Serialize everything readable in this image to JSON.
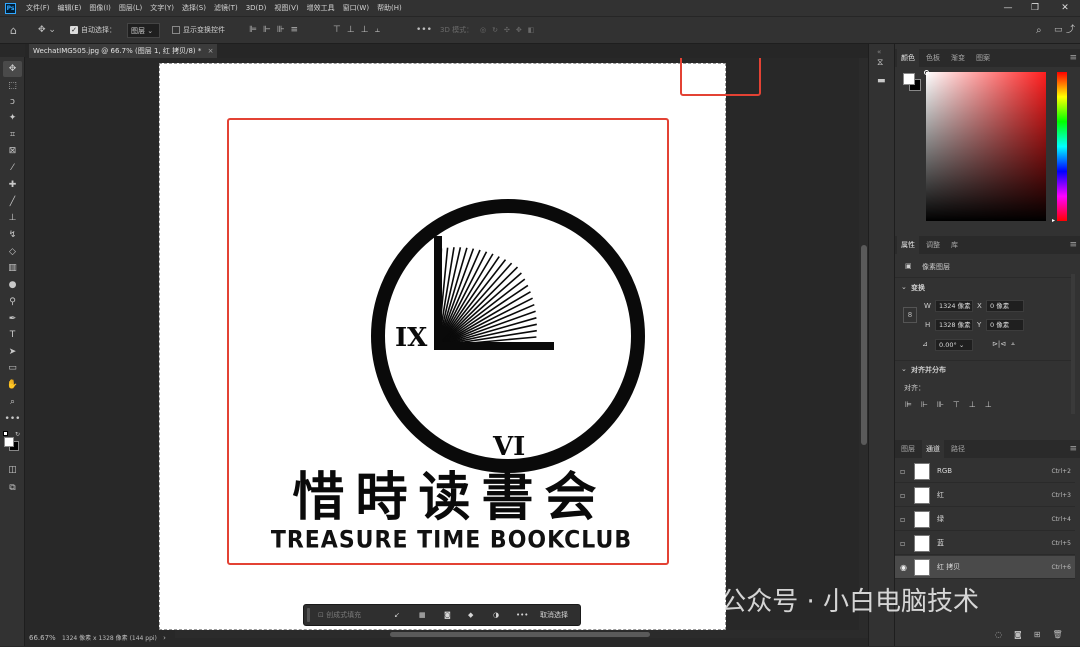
{
  "menubar": {
    "logo": "Ps",
    "items": [
      "文件(F)",
      "编辑(E)",
      "图像(I)",
      "图层(L)",
      "文字(Y)",
      "选择(S)",
      "滤镜(T)",
      "3D(D)",
      "视图(V)",
      "增效工具",
      "窗口(W)",
      "帮助(H)"
    ],
    "window_controls": [
      "—",
      "❐",
      "✕"
    ]
  },
  "options": {
    "auto_select_label": "自动选择：",
    "auto_select_value": "图层",
    "show_transform_label": "显示变换控件",
    "mode_3d_label": "3D 模式："
  },
  "document_tab": {
    "title": "WechatIMG505.jpg @ 66.7% (图层 1, 红 拷贝/8) *",
    "close": "×"
  },
  "canvas": {
    "logo_cn": "惜時读書会",
    "logo_en": "TREASURE TIME BOOKCLUB",
    "numeral_left": "IX",
    "numeral_bottom": "VI"
  },
  "context_bar": {
    "fill_label": "创成式填充",
    "deselect_label": "取消选择",
    "more": "•••"
  },
  "status": {
    "zoom": "66.67%",
    "info": "1324 像素 x 1328 像素 (144 ppi)",
    "arrow": "›"
  },
  "color_panel": {
    "tabs": [
      "颜色",
      "色板",
      "渐变",
      "图案"
    ]
  },
  "properties_panel": {
    "tabs": [
      "属性",
      "调整",
      "库"
    ],
    "layer_type": "像素图层",
    "transform_header": "变换",
    "w_label": "W",
    "w_value": "1324 像素",
    "x_label": "X",
    "x_value": "0 像素",
    "h_label": "H",
    "h_value": "1328 像素",
    "y_label": "Y",
    "y_value": "0 像素",
    "angle_value": "0.00°",
    "align_header": "对齐并分布",
    "align_label": "对齐："
  },
  "channels_panel": {
    "tabs": [
      "图层",
      "通道",
      "路径"
    ],
    "channels": [
      {
        "name": "RGB",
        "shortcut": "Ctrl+2",
        "visible": false,
        "selected": false
      },
      {
        "name": "红",
        "shortcut": "Ctrl+3",
        "visible": false,
        "selected": false
      },
      {
        "name": "绿",
        "shortcut": "Ctrl+4",
        "visible": false,
        "selected": false
      },
      {
        "name": "蓝",
        "shortcut": "Ctrl+5",
        "visible": false,
        "selected": false
      },
      {
        "name": "红 拷贝",
        "shortcut": "Ctrl+6",
        "visible": true,
        "selected": true
      }
    ]
  },
  "watermark": "公众号 · 小白电脑技术",
  "colors": {
    "accent_red": "#e34234",
    "panel_bg": "#323232",
    "workspace_bg": "#282828"
  }
}
